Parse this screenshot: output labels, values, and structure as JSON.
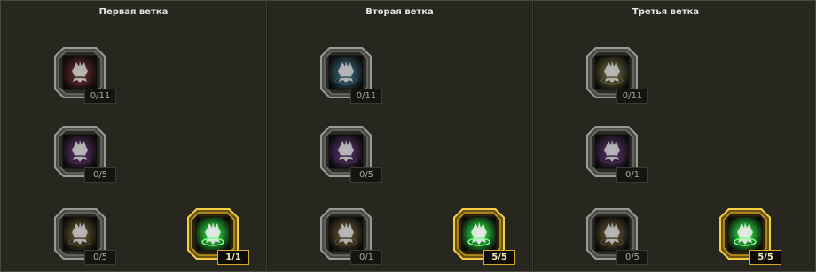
{
  "branches": [
    {
      "title": "Первая ветка",
      "skills": [
        {
          "row": 0,
          "col": 0,
          "color": "#8a2020",
          "level": "0/11",
          "active": false
        },
        {
          "row": 1,
          "col": 0,
          "color": "#6a2a8a",
          "level": "0/5",
          "active": false
        },
        {
          "row": 2,
          "col": 0,
          "color": "#6f5318",
          "level": "0/5",
          "active": false
        },
        {
          "row": 2,
          "col": 1,
          "color": "#22b336",
          "level": "1/1",
          "active": true
        }
      ]
    },
    {
      "title": "Вторая ветка",
      "skills": [
        {
          "row": 0,
          "col": 0,
          "color": "#1e6a8c",
          "level": "0/11",
          "active": false
        },
        {
          "row": 1,
          "col": 0,
          "color": "#6a2a8a",
          "level": "0/5",
          "active": false
        },
        {
          "row": 2,
          "col": 0,
          "color": "#6f5318",
          "level": "0/1",
          "active": false
        },
        {
          "row": 2,
          "col": 1,
          "color": "#22b336",
          "level": "5/5",
          "active": true
        }
      ]
    },
    {
      "title": "Третья ветка",
      "skills": [
        {
          "row": 0,
          "col": 0,
          "color": "#6d6a1e",
          "level": "0/11",
          "active": false
        },
        {
          "row": 1,
          "col": 0,
          "color": "#6a2a8a",
          "level": "0/1",
          "active": false
        },
        {
          "row": 2,
          "col": 0,
          "color": "#6f5318",
          "level": "0/5",
          "active": false
        },
        {
          "row": 2,
          "col": 1,
          "color": "#22b336",
          "level": "5/5",
          "active": true
        }
      ]
    }
  ]
}
